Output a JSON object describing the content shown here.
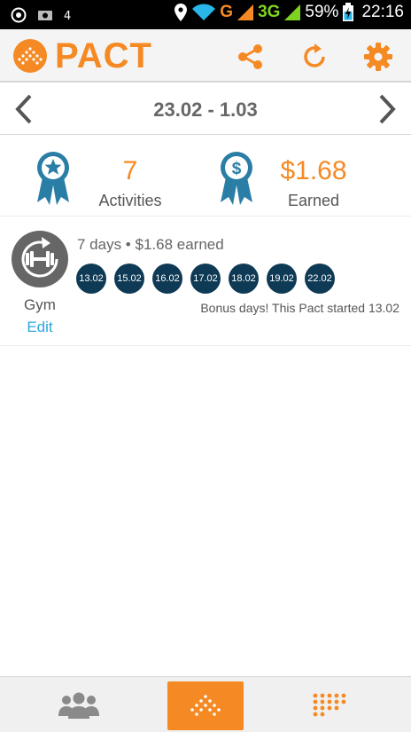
{
  "status_bar": {
    "network_g": "G",
    "network_3g": "3G",
    "battery": "59%",
    "time": "22:16",
    "icons": [
      "vpn-icon",
      "screenshot-icon",
      "headset-icon",
      "location-icon",
      "wifi-icon",
      "signal-icon",
      "battery-charging-icon"
    ]
  },
  "app_bar": {
    "logo_text": "PACT",
    "icons": [
      "share-icon",
      "refresh-icon",
      "gear-icon"
    ]
  },
  "week_nav": {
    "range": "23.02 - 1.03",
    "prev_icon": "chevron-left-icon",
    "next_icon": "chevron-right-icon"
  },
  "summary": {
    "activities_value": "7",
    "activities_label": "Activities",
    "earned_value": "$1.68",
    "earned_label": "Earned"
  },
  "pact": {
    "name": "Gym",
    "edit_label": "Edit",
    "summary": "7 days • $1.68 earned",
    "days": [
      "13.02",
      "15.02",
      "16.02",
      "17.02",
      "18.02",
      "19.02",
      "22.02"
    ],
    "note": "Bonus days! This Pact started 13.02"
  },
  "tabs": {
    "items": [
      "group-icon",
      "pact-logo-icon",
      "dot-grid-icon"
    ],
    "active": "pact-logo-icon"
  },
  "colors": {
    "accent": "#f58a24",
    "ribbon": "#2a7ea6",
    "day_circle": "#0f3a55",
    "link": "#2ca7dc"
  }
}
